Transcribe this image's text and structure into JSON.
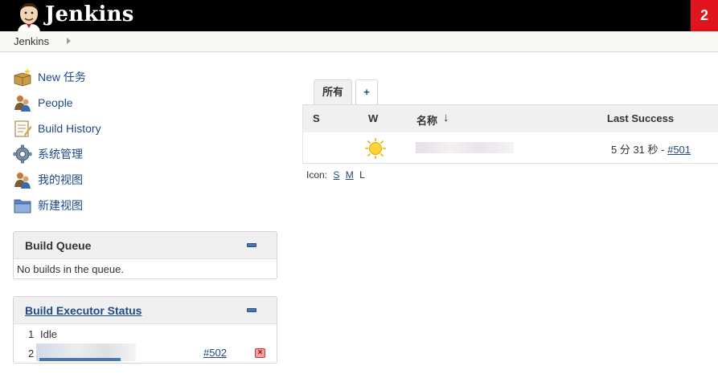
{
  "header": {
    "brand": "Jenkins",
    "notification_count": "2"
  },
  "breadcrumb": {
    "items": [
      "Jenkins"
    ]
  },
  "tasks": [
    {
      "label": "New 任务",
      "icon": "new-item-icon"
    },
    {
      "label": "People",
      "icon": "people-icon"
    },
    {
      "label": "Build History",
      "icon": "notepad-icon"
    },
    {
      "label": "系统管理",
      "icon": "gear-icon"
    },
    {
      "label": "我的视图",
      "icon": "user-icon"
    },
    {
      "label": "新建视图",
      "icon": "folder-icon"
    }
  ],
  "build_queue": {
    "title": "Build Queue",
    "empty_text": "No builds in the queue."
  },
  "executors": {
    "title": "Build Executor Status",
    "rows": [
      {
        "num": "1",
        "state": "Idle"
      },
      {
        "num": "2",
        "link": "#502"
      }
    ]
  },
  "tabs": [
    {
      "label": "所有",
      "active": true
    },
    {
      "label": "+",
      "active": false
    }
  ],
  "table": {
    "columns": {
      "s": "S",
      "w": "W",
      "name": "名称",
      "sort_arrow": "↓",
      "last_success": "Last Success"
    },
    "rows": [
      {
        "weather": "sunny",
        "last_success_text": "5 分 31 秒 - ",
        "last_success_link": "#501"
      }
    ]
  },
  "icon_size": {
    "label": "Icon:",
    "options": [
      "S",
      "M",
      "L"
    ],
    "current": "L"
  },
  "colors": {
    "link": "#204a87",
    "header_bg": "#000000",
    "notification_bg": "#e0141d"
  }
}
